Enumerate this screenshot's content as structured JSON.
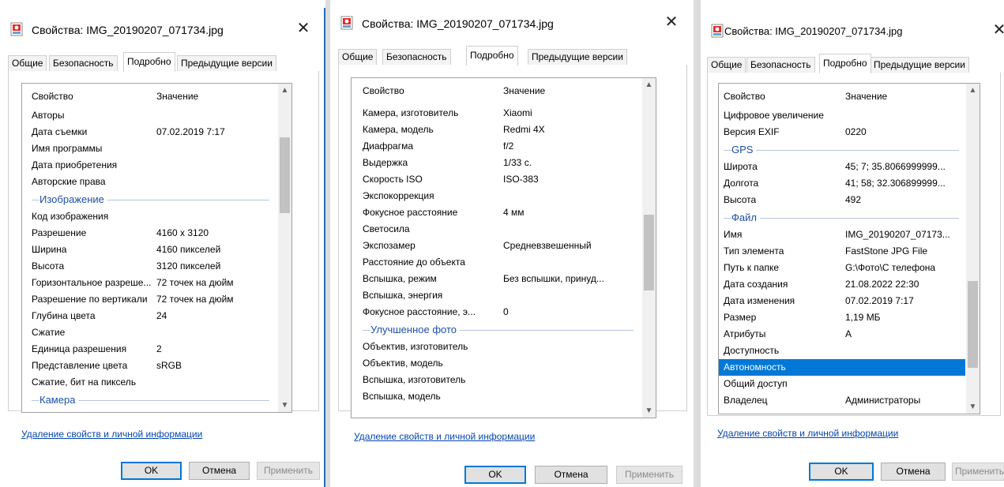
{
  "dialogs": [
    {
      "title": "Свойства: IMG_20190207_071734.jpg",
      "close_glyph": "✕",
      "tabs": [
        "Общие",
        "Безопасность",
        "Подробно",
        "Предыдущие версии"
      ],
      "active_tab": "Подробно",
      "columns": [
        "Свойство",
        "Значение"
      ],
      "rows": [
        {
          "kind": "prop",
          "name": "Авторы",
          "value": ""
        },
        {
          "kind": "prop",
          "name": "Дата съемки",
          "value": "07.02.2019 7:17"
        },
        {
          "kind": "prop",
          "name": "Имя программы",
          "value": ""
        },
        {
          "kind": "prop",
          "name": "Дата приобретения",
          "value": ""
        },
        {
          "kind": "prop",
          "name": "Авторские права",
          "value": ""
        },
        {
          "kind": "group",
          "name": "Изображение"
        },
        {
          "kind": "prop",
          "name": "Код изображения",
          "value": ""
        },
        {
          "kind": "prop",
          "name": "Разрешение",
          "value": "4160 x 3120"
        },
        {
          "kind": "prop",
          "name": "Ширина",
          "value": "4160 пикселей"
        },
        {
          "kind": "prop",
          "name": "Высота",
          "value": "3120 пикселей"
        },
        {
          "kind": "prop",
          "name": "Горизонтальное разреше...",
          "value": "72 точек на дюйм"
        },
        {
          "kind": "prop",
          "name": "Разрешение по вертикали",
          "value": "72 точек на дюйм"
        },
        {
          "kind": "prop",
          "name": "Глубина цвета",
          "value": "24"
        },
        {
          "kind": "prop",
          "name": "Сжатие",
          "value": ""
        },
        {
          "kind": "prop",
          "name": "Единица разрешения",
          "value": "2"
        },
        {
          "kind": "prop",
          "name": "Представление цвета",
          "value": "sRGB"
        },
        {
          "kind": "prop",
          "name": "Сжатие, бит на пиксель",
          "value": ""
        },
        {
          "kind": "group",
          "name": "Камера"
        }
      ],
      "scroll_position": 0.18,
      "remove_link": "Удаление свойств и личной информации",
      "buttons": {
        "ok": "OK",
        "cancel": "Отмена",
        "apply": "Применить"
      }
    },
    {
      "title": "Свойства: IMG_20190207_071734.jpg",
      "close_glyph": "✕",
      "tabs": [
        "Общие",
        "Безопасность",
        "Подробно",
        "Предыдущие версии"
      ],
      "active_tab": "Подробно",
      "columns": [
        "Свойство",
        "Значение"
      ],
      "rows": [
        {
          "kind": "prop",
          "name": "Камера, изготовитель",
          "value": "Xiaomi"
        },
        {
          "kind": "prop",
          "name": "Камера, модель",
          "value": "Redmi 4X"
        },
        {
          "kind": "prop",
          "name": "Диафрагма",
          "value": "f/2"
        },
        {
          "kind": "prop",
          "name": "Выдержка",
          "value": "1/33 с."
        },
        {
          "kind": "prop",
          "name": "Скорость ISO",
          "value": "ISO-383"
        },
        {
          "kind": "prop",
          "name": "Экспокоррекция",
          "value": ""
        },
        {
          "kind": "prop",
          "name": "Фокусное расстояние",
          "value": "4 мм"
        },
        {
          "kind": "prop",
          "name": "Светосила",
          "value": ""
        },
        {
          "kind": "prop",
          "name": "Экспозамер",
          "value": "Средневзвешенный"
        },
        {
          "kind": "prop",
          "name": "Расстояние до объекта",
          "value": ""
        },
        {
          "kind": "prop",
          "name": "Вспышка, режим",
          "value": "Без вспышки, принуд..."
        },
        {
          "kind": "prop",
          "name": "Вспышка, энергия",
          "value": ""
        },
        {
          "kind": "prop",
          "name": "Фокусное расстояние, э...",
          "value": "0"
        },
        {
          "kind": "group",
          "name": "Улучшенное фото"
        },
        {
          "kind": "prop",
          "name": "Объектив, изготовитель",
          "value": ""
        },
        {
          "kind": "prop",
          "name": "Объектив, модель",
          "value": ""
        },
        {
          "kind": "prop",
          "name": "Вспышка, изготовитель",
          "value": ""
        },
        {
          "kind": "prop",
          "name": "Вспышка, модель",
          "value": ""
        }
      ],
      "scroll_position": 0.52,
      "remove_link": "Удаление свойств и личной информации",
      "buttons": {
        "ok": "OK",
        "cancel": "Отмена",
        "apply": "Применить"
      }
    },
    {
      "title": "Свойства: IMG_20190207_071734.jpg",
      "close_glyph": "✕",
      "tabs": [
        "Общие",
        "Безопасность",
        "Подробно",
        "Предыдущие версии"
      ],
      "active_tab": "Подробно",
      "columns": [
        "Свойство",
        "Значение"
      ],
      "rows": [
        {
          "kind": "prop",
          "name": "Цифровое увеличение",
          "value": ""
        },
        {
          "kind": "prop",
          "name": "Версия EXIF",
          "value": "0220"
        },
        {
          "kind": "group",
          "name": "GPS"
        },
        {
          "kind": "prop",
          "name": "Широта",
          "value": "45; 7; 35.8066999999..."
        },
        {
          "kind": "prop",
          "name": "Долгота",
          "value": "41; 58; 32.306899999..."
        },
        {
          "kind": "prop",
          "name": "Высота",
          "value": "492"
        },
        {
          "kind": "group",
          "name": "Файл"
        },
        {
          "kind": "prop",
          "name": "Имя",
          "value": "IMG_20190207_07173..."
        },
        {
          "kind": "prop",
          "name": "Тип элемента",
          "value": "FastStone JPG File"
        },
        {
          "kind": "prop",
          "name": "Путь к папке",
          "value": "G:\\Фото\\С телефона"
        },
        {
          "kind": "prop",
          "name": "Дата создания",
          "value": "21.08.2022 22:30"
        },
        {
          "kind": "prop",
          "name": "Дата изменения",
          "value": "07.02.2019 7:17"
        },
        {
          "kind": "prop",
          "name": "Размер",
          "value": "1,19 МБ"
        },
        {
          "kind": "prop",
          "name": "Атрибуты",
          "value": "A"
        },
        {
          "kind": "prop",
          "name": "Доступность",
          "value": ""
        },
        {
          "kind": "prop",
          "name": "Автономность",
          "value": "",
          "selected": true
        },
        {
          "kind": "prop",
          "name": "Общий доступ",
          "value": ""
        },
        {
          "kind": "prop",
          "name": "Владелец",
          "value": "Администраторы"
        }
      ],
      "scroll_position": 0.85,
      "remove_link": "Удаление свойств и личной информации",
      "buttons": {
        "ok": "OK",
        "cancel": "Отмена",
        "apply": "Применить"
      }
    }
  ],
  "colors": {
    "accent": "#0078d7",
    "link": "#0645ad",
    "group_header": "#1f4fa8",
    "selection": "#0078d7",
    "window_border": "#2b6cb8"
  },
  "icons": {
    "app": "photo-file-icon",
    "close": "close-icon",
    "scroll_up": "chevron-up-icon",
    "scroll_down": "chevron-down-icon"
  }
}
